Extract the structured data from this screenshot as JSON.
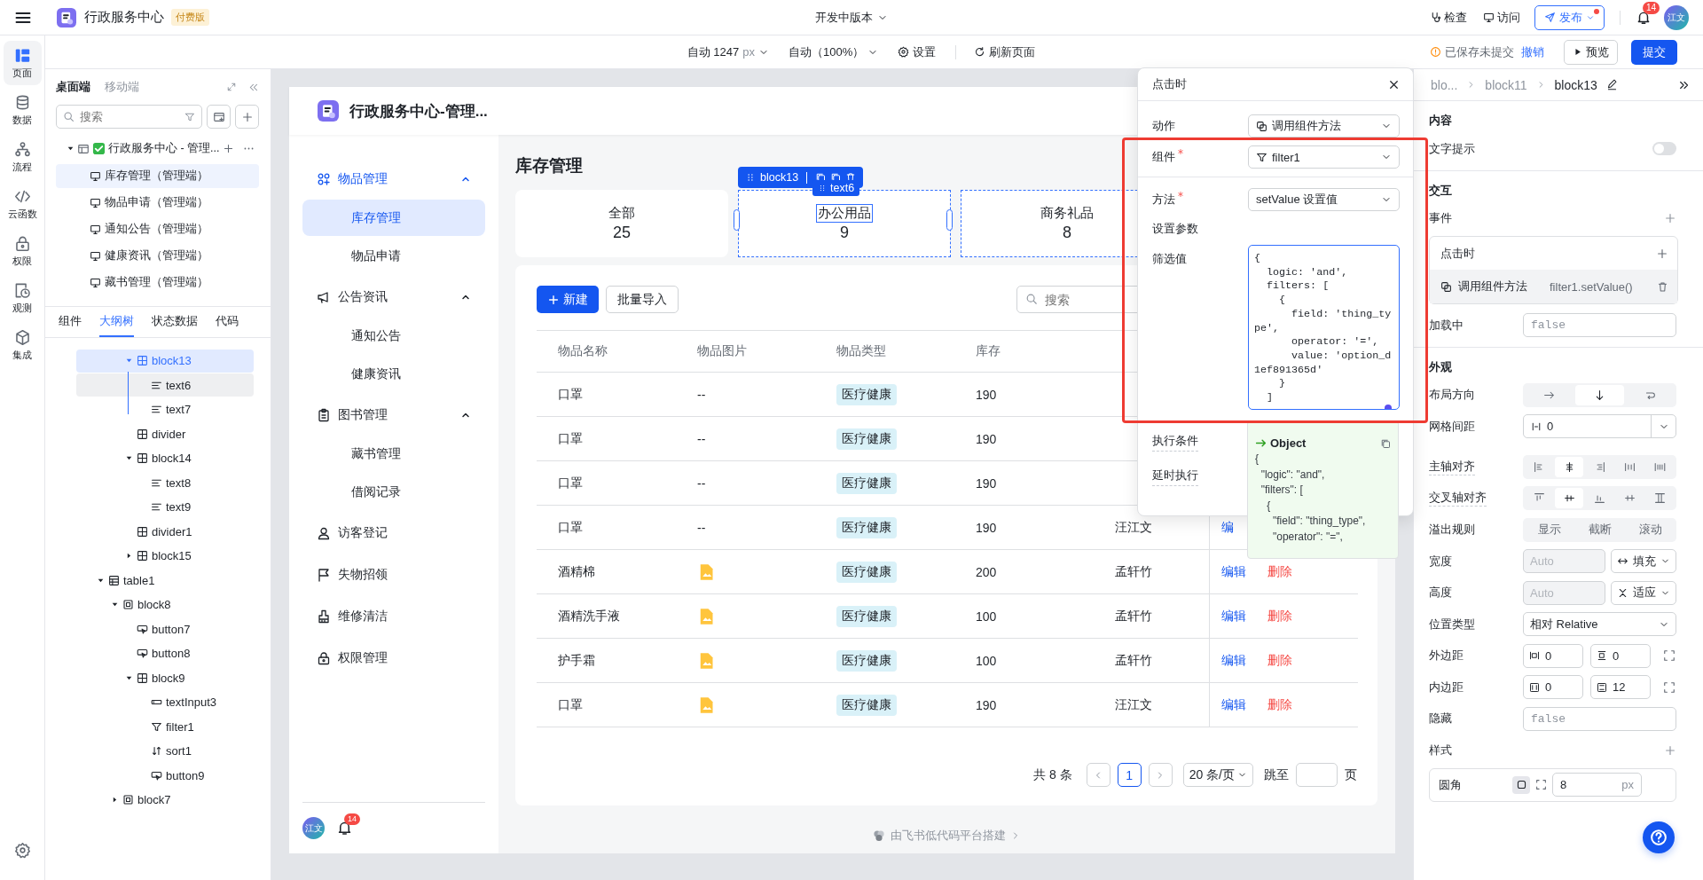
{
  "topbar": {
    "app_title": "行政服务中心",
    "plan_badge": "付费版",
    "version": "开发中版本",
    "actions": [
      {
        "label": "检查"
      },
      {
        "label": "访问"
      }
    ],
    "publish": {
      "label": "发布",
      "dot": true
    },
    "notifications": "14",
    "avatar": "江文"
  },
  "rail": [
    {
      "label": "页面",
      "selected": true
    },
    {
      "label": "数据",
      "selected": false
    },
    {
      "label": "流程",
      "selected": false
    },
    {
      "label": "云函数",
      "selected": false
    },
    {
      "label": "权限",
      "selected": false
    },
    {
      "label": "观测",
      "selected": false
    },
    {
      "label": "集成",
      "selected": false
    }
  ],
  "toolbar": {
    "width_value": "自动 1247",
    "width_unit": "px",
    "zoom": "自动（100%）",
    "settings": "设置",
    "refresh": "刷新页面",
    "save_status": "已保存未提交",
    "revert": "撤销",
    "preview": "预览",
    "submit": "提交"
  },
  "left_panel": {
    "device_tabs": [
      {
        "label": "桌面端",
        "selected": true
      },
      {
        "label": "移动端",
        "selected": false
      }
    ],
    "search": {
      "placeholder": "搜索"
    },
    "pages_tree": {
      "label": "行政服务中心 - 管理...",
      "expanded": true,
      "children": [
        {
          "label": "库存管理（管理端）",
          "selected": true
        },
        {
          "label": "物品申请（管理端）",
          "selected": false
        },
        {
          "label": "通知公告（管理端）",
          "selected": false
        },
        {
          "label": "健康资讯（管理端）",
          "selected": false
        },
        {
          "label": "藏书管理（管理端）",
          "selected": false
        }
      ]
    },
    "panel_tabs": [
      {
        "label": "组件",
        "selected": false
      },
      {
        "label": "大纲树",
        "selected": true
      },
      {
        "label": "状态数据",
        "selected": false
      },
      {
        "label": "代码",
        "selected": false
      }
    ],
    "outline": [
      {
        "children": [
          {
            "children": [
              {
                "label": "block13",
                "kind": "grid",
                "expanded": true,
                "selected": true,
                "hovered": false,
                "children": [
                  {
                    "label": "text6",
                    "kind": "text",
                    "selected": false,
                    "hovered": true
                  },
                  {
                    "label": "text7",
                    "kind": "text",
                    "selected": false,
                    "hovered": false
                  }
                ]
              },
              {
                "label": "divider",
                "kind": "grid",
                "selected": false,
                "hovered": false
              },
              {
                "label": "block14",
                "kind": "grid",
                "expanded": true,
                "selected": false,
                "hovered": false,
                "children": [
                  {
                    "label": "text8",
                    "kind": "text",
                    "selected": false,
                    "hovered": false
                  },
                  {
                    "label": "text9",
                    "kind": "text",
                    "selected": false,
                    "hovered": false
                  }
                ]
              },
              {
                "label": "divider1",
                "kind": "grid",
                "selected": false,
                "hovered": false
              },
              {
                "label": "block15",
                "kind": "grid",
                "expanded": false,
                "selected": false,
                "hovered": false
              }
            ]
          }
        ]
      },
      {
        "label": "table1",
        "kind": "table",
        "expanded": true,
        "selected": false,
        "hovered": false,
        "children": [
          {
            "label": "block8",
            "kind": "box",
            "expanded": true,
            "selected": false,
            "hovered": false,
            "children": [
              {
                "label": "button7",
                "kind": "button",
                "selected": false,
                "hovered": false
              },
              {
                "label": "button8",
                "kind": "button",
                "selected": false,
                "hovered": false
              },
              {
                "label": "block9",
                "kind": "grid",
                "expanded": true,
                "selected": false,
                "hovered": false,
                "children": [
                  {
                    "label": "textInput3",
                    "kind": "input",
                    "selected": false,
                    "hovered": false
                  },
                  {
                    "label": "filter1",
                    "kind": "filter",
                    "selected": false,
                    "hovered": false
                  },
                  {
                    "label": "sort1",
                    "kind": "sort",
                    "selected": false,
                    "hovered": false
                  },
                  {
                    "label": "button9",
                    "kind": "button",
                    "selected": false,
                    "hovered": false
                  }
                ]
              }
            ]
          },
          {
            "label": "block7",
            "kind": "box",
            "expanded": false,
            "selected": false,
            "hovered": false
          }
        ]
      }
    ]
  },
  "app": {
    "title": "行政服务中心-管理...",
    "nav": [
      {
        "label": "物品管理",
        "expanded": true,
        "active": true,
        "children": [
          {
            "label": "库存管理",
            "selected": true
          },
          {
            "label": "物品申请",
            "selected": false
          }
        ]
      },
      {
        "label": "公告资讯",
        "expanded": true,
        "active": false,
        "children": [
          {
            "label": "通知公告",
            "selected": false
          },
          {
            "label": "健康资讯",
            "selected": false
          }
        ]
      },
      {
        "label": "图书管理",
        "expanded": true,
        "active": false,
        "children": [
          {
            "label": "藏书管理",
            "selected": false
          },
          {
            "label": "借阅记录",
            "selected": false
          }
        ]
      },
      {
        "label": "访客登记",
        "active": false
      },
      {
        "label": "失物招领",
        "active": false
      },
      {
        "label": "维修清洁",
        "active": false
      },
      {
        "label": "权限管理",
        "active": false
      }
    ],
    "user": {
      "avatar": "江文",
      "notifications": "14"
    },
    "page_title": "库存管理",
    "stats": [
      {
        "label": "全部",
        "value": "25",
        "selected": false,
        "outlined": false
      },
      {
        "label": "办公用品",
        "value": "9",
        "selected": true,
        "outlined": true
      },
      {
        "label": "商务礼品",
        "value": "8",
        "selected": false,
        "outlined": true
      }
    ],
    "editor_tags": {
      "block": "block13",
      "element": "text6"
    },
    "new_button": "新建",
    "import_button": "批量导入",
    "search": {
      "placeholder": "搜索"
    },
    "table": {
      "columns": [
        "物品名称",
        "物品图片",
        "物品类型",
        "库存"
      ],
      "rows": [
        {
          "name": "口罩",
          "image": "--",
          "type": "医疗健康",
          "stock": "190",
          "actions": []
        },
        {
          "name": "口罩",
          "image": "--",
          "type": "医疗健康",
          "stock": "190",
          "actions": []
        },
        {
          "name": "口罩",
          "image": "--",
          "type": "医疗健康",
          "stock": "190",
          "actions": []
        },
        {
          "name": "口罩",
          "image": "--",
          "type": "医疗健康",
          "stock": "190",
          "owner": "汪江文",
          "actions": [
            {
              "label": "编",
              "kind": "edit"
            }
          ]
        },
        {
          "name": "酒精棉",
          "image_file": true,
          "type": "医疗健康",
          "stock": "200",
          "owner": "孟轩竹",
          "actions": [
            {
              "label": "编辑",
              "kind": "edit"
            },
            {
              "label": "删除",
              "kind": "delete"
            }
          ]
        },
        {
          "name": "酒精洗手液",
          "image_file": true,
          "type": "医疗健康",
          "stock": "100",
          "owner": "孟轩竹",
          "actions": [
            {
              "label": "编辑",
              "kind": "edit"
            },
            {
              "label": "删除",
              "kind": "delete"
            }
          ]
        },
        {
          "name": "护手霜",
          "image_file": true,
          "type": "医疗健康",
          "stock": "100",
          "owner": "孟轩竹",
          "actions": [
            {
              "label": "编辑",
              "kind": "edit"
            },
            {
              "label": "删除",
              "kind": "delete"
            }
          ]
        },
        {
          "name": "口罩",
          "image_file": true,
          "type": "医疗健康",
          "stock": "190",
          "owner": "汪江文",
          "actions": [
            {
              "label": "编辑",
              "kind": "edit"
            },
            {
              "label": "删除",
              "kind": "delete"
            }
          ]
        }
      ]
    },
    "pagination": {
      "total": "共 8 条",
      "pages": [
        {
          "label": "1",
          "selected": true
        }
      ],
      "page_size": "20 条/页",
      "jump_label": "跳至",
      "jump_suffix": "页"
    },
    "footer": "由飞书低代码平台搭建"
  },
  "event_popup": {
    "title": "点击时",
    "fields": [
      {
        "label": "动作",
        "required": false,
        "value": "调用组件方法"
      },
      {
        "label": "组件",
        "required": true,
        "value": "filter1"
      },
      {
        "label": "方法",
        "required": true,
        "value": "setValue 设置值"
      }
    ],
    "params_label": "设置参数",
    "filter_label": "筛选值",
    "code": "{\n  logic: 'and',\n  filters: [\n    {\n      field: 'thing_ty\npe',\n      operator: '=',\n      value: 'option_d\n1ef891365d'\n    }\n  ]",
    "extra_labels": [
      "执行条件",
      "延时执行"
    ],
    "result": {
      "title": "Object",
      "text": "{\n  \"logic\": \"and\",\n  \"filters\": [\n    {\n      \"field\": \"thing_type\",\n      \"operator\": \"=\","
    }
  },
  "inspector": {
    "breadcrumb": [
      "blo...",
      "block11",
      "block13"
    ],
    "sections": [
      {
        "title": "内容",
        "rows": [
          {
            "kind": "toggle",
            "label": "文字提示",
            "on": false
          }
        ]
      },
      {
        "title": "交互",
        "rows": [
          {
            "kind": "events",
            "label": "事件",
            "events": [
              {
                "name": "点击时",
                "actions": [
                  {
                    "type": "调用组件方法",
                    "target": "filter1.setValue()"
                  }
                ]
              }
            ]
          },
          {
            "kind": "input",
            "label": "加载中",
            "placeholder": "false"
          }
        ]
      },
      {
        "title": "外观",
        "rows": [
          {
            "kind": "segmented",
            "label": "布局方向",
            "options": [
              {
                "selected": false
              },
              {
                "selected": true
              },
              {
                "selected": false
              }
            ]
          },
          {
            "kind": "gap",
            "label": "网格间距",
            "value": "0"
          },
          {
            "kind": "segmented",
            "label": "主轴对齐",
            "hint": true,
            "options": [
              {
                "selected": false
              },
              {
                "selected": true
              },
              {
                "selected": false
              },
              {
                "selected": false
              },
              {
                "selected": false
              }
            ]
          },
          {
            "kind": "segmented",
            "label": "交叉轴对齐",
            "hint": true,
            "options": [
              {
                "selected": false
              },
              {
                "selected": true
              },
              {
                "selected": false
              },
              {
                "selected": false
              },
              {
                "selected": false
              }
            ]
          },
          {
            "kind": "segmented",
            "label": "溢出规则",
            "options": [
              {
                "text": "显示",
                "selected": false
              },
              {
                "text": "截断",
                "selected": false
              },
              {
                "text": "滚动",
                "selected": false
              }
            ]
          },
          {
            "kind": "size",
            "label": "宽度",
            "placeholder": "Auto",
            "disabled": true,
            "mode": "填充"
          },
          {
            "kind": "size",
            "label": "高度",
            "placeholder": "Auto",
            "disabled": true,
            "mode": "适应"
          },
          {
            "kind": "select",
            "label": "位置类型",
            "value": "相对 Relative"
          },
          {
            "kind": "pair",
            "label": "外边距",
            "values": [
              {
                "value": "0"
              },
              {
                "value": "0"
              }
            ]
          },
          {
            "kind": "pair",
            "label": "内边距",
            "values": [
              {
                "value": "0"
              },
              {
                "value": "12"
              }
            ]
          },
          {
            "kind": "input",
            "label": "隐藏",
            "placeholder": "false"
          },
          {
            "kind": "styles",
            "label": "样式",
            "items": [
              {
                "label": "圆角",
                "value": "8",
                "unit": "px"
              }
            ]
          }
        ]
      }
    ]
  }
}
